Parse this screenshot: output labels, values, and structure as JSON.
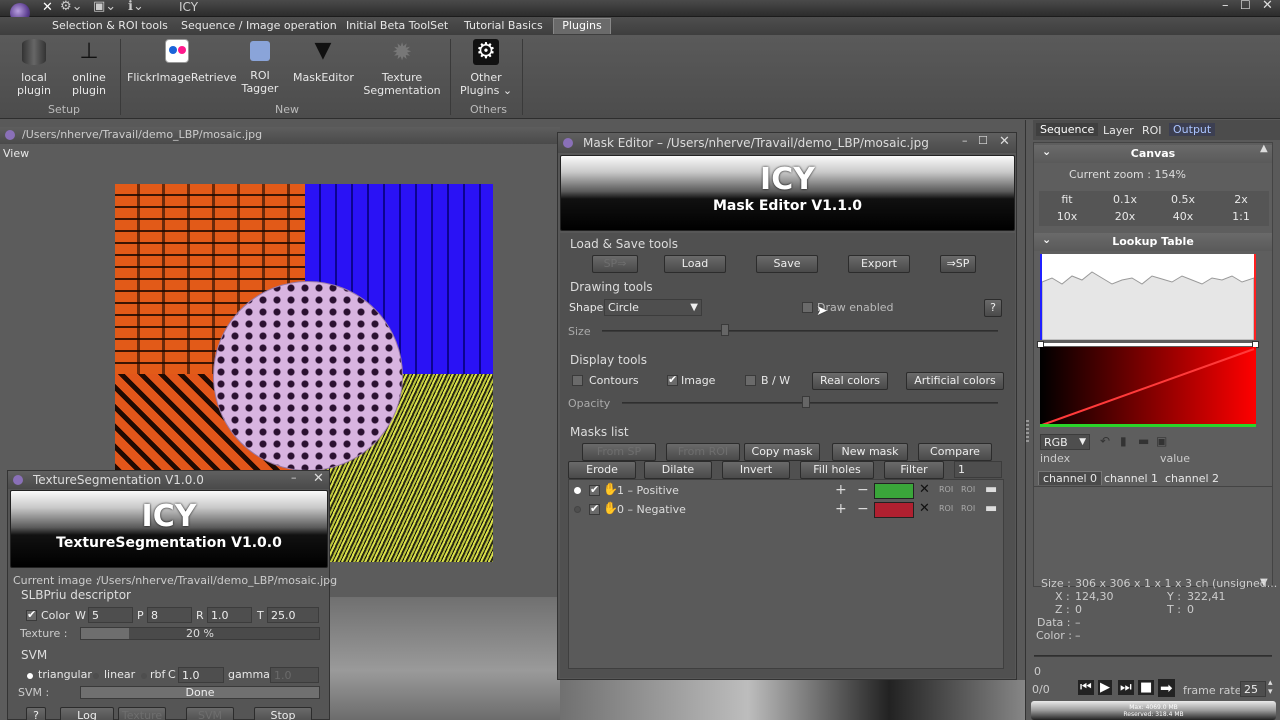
{
  "app": {
    "title": "ICY"
  },
  "ribbon": {
    "tabs": [
      "Selection & ROI tools",
      "Sequence / Image operation",
      "Initial Beta ToolSet",
      "Tutorial Basics",
      "Plugins"
    ],
    "items": [
      {
        "line1": "local",
        "line2": "plugin"
      },
      {
        "line1": "online",
        "line2": "plugin"
      },
      {
        "line1": "FlickrImageRetrieve",
        "line2": ""
      },
      {
        "line1": "ROI",
        "line2": "Tagger"
      },
      {
        "line1": "MaskEditor",
        "line2": ""
      },
      {
        "line1": "Texture",
        "line2": "Segmentation"
      },
      {
        "line1": "Other",
        "line2": "Plugins ⌄"
      }
    ],
    "groups": [
      "Setup",
      "New",
      "Others"
    ]
  },
  "viewer": {
    "path": "/Users/nherve/Travail/demo_LBP/mosaic.jpg",
    "menu": "View"
  },
  "mask_editor": {
    "title": "Mask Editor – /Users/nherve/Travail/demo_LBP/mosaic.jpg",
    "header": "ICY",
    "header_sub": "Mask Editor V1.1.0",
    "load_save": {
      "title": "Load & Save tools",
      "buttons": [
        "SP⇒",
        "Load",
        "Save",
        "Export",
        "⇒SP"
      ]
    },
    "drawing": {
      "title": "Drawing tools",
      "shape_label": "Shape",
      "shape_value": "Circle",
      "draw_enabled": "Draw enabled",
      "help": "?",
      "size_label": "Size"
    },
    "display": {
      "title": "Display tools",
      "contours": "Contours",
      "image": "Image",
      "bw": "B / W",
      "real_colors": "Real colors",
      "artificial_colors": "Artificial colors",
      "opacity": "Opacity"
    },
    "masks": {
      "title": "Masks list",
      "row1": [
        "From SP",
        "From ROI",
        "Copy mask",
        "New mask",
        "Compare"
      ],
      "row2": [
        "Erode",
        "Dilate",
        "Invert",
        "Fill holes",
        "Filter"
      ],
      "filter_value": "1",
      "list": [
        {
          "label": "1 – Positive",
          "color": "#3aa63a"
        },
        {
          "label": "0 – Negative",
          "color": "#b02030"
        }
      ]
    }
  },
  "texture": {
    "title": "TextureSegmentation V1.0.0",
    "header": "ICY",
    "header_sub": "TextureSegmentation V1.0.0",
    "current_image_label": "Current image :",
    "current_image": "/Users/nherve/Travail/demo_LBP/mosaic.jpg",
    "descriptor": "SLBPriu descriptor",
    "color": "Color",
    "w_label": "W",
    "w": "5",
    "p_label": "P",
    "p": "8",
    "r_label": "R",
    "r": "1.0",
    "t_label": "T",
    "t": "25.0",
    "texture_label": "Texture :",
    "texture_progress": "20 %",
    "texture_fraction": 0.2,
    "svm": "SVM",
    "triangular": "triangular",
    "linear": "linear",
    "rbf": "rbf",
    "c_label": "C",
    "c": "1.0",
    "gamma": "gamma",
    "gamma_value": "1.0",
    "svm_label": "SVM :",
    "svm_status": "Done",
    "buttons": [
      "?",
      "Log",
      "Texture",
      "SVM",
      "Stop"
    ]
  },
  "inspector": {
    "tabs": [
      "Sequence",
      "Layer",
      "ROI",
      "Output"
    ],
    "canvas_title": "Canvas",
    "zoom": "Current zoom : 154%",
    "zoom_buttons": [
      "fit",
      "0.1x",
      "0.5x",
      "2x",
      "10x",
      "20x",
      "40x",
      "1:1"
    ],
    "lut_title": "Lookup Table",
    "rgb": "RGB",
    "index": "index",
    "value": "value",
    "channels": [
      "channel 0",
      "channel 1",
      "channel 2"
    ],
    "info": {
      "size_label": "Size :",
      "size": "306 x 306 x 1 x 1 x 3 ch (unsigned...",
      "x_label": "X :",
      "x": "124,30",
      "y_label": "Y :",
      "y": "322,41",
      "z_label": "Z :",
      "z": "0",
      "t_label": "T :",
      "t": "0",
      "data_label": "Data :",
      "data": "–",
      "color_label": "Color :",
      "color": "–"
    },
    "frame": {
      "pos": "0",
      "count": "0/0",
      "frame_rate_label": "frame rate",
      "frame_rate": "25"
    },
    "memory": {
      "max": "Max: 4069.0 MB",
      "reserved": "Reserved: 318.4 MB"
    }
  }
}
